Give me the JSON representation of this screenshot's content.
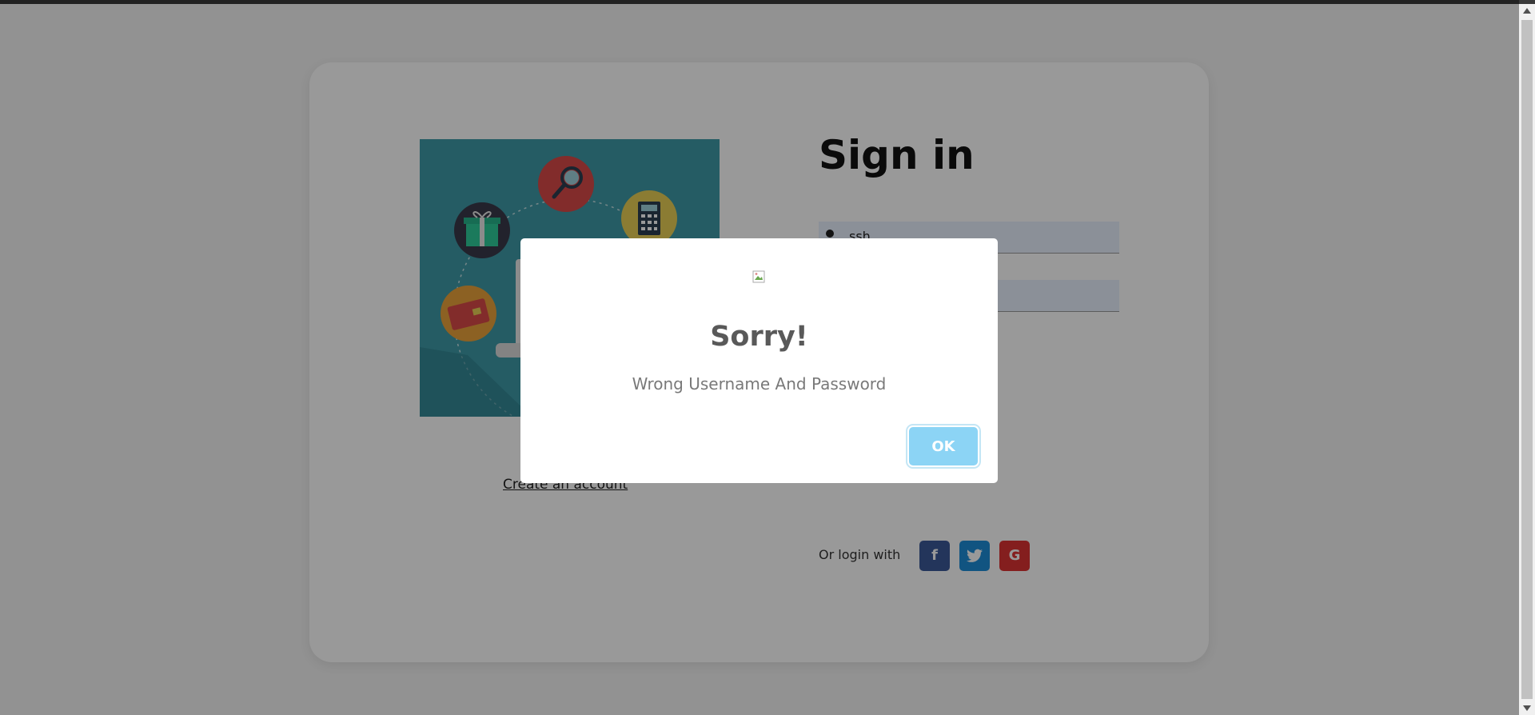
{
  "page": {
    "illustration_alt": "online shopping illustration",
    "create_account_link": "Create an account",
    "title": "Sign in",
    "username_value": "ssh",
    "password_value": "",
    "social_label": "Or login with",
    "social": {
      "facebook": "f",
      "twitter": "t",
      "google": "G"
    }
  },
  "modal": {
    "title": "Sorry!",
    "message": "Wrong Username And Password",
    "ok_label": "OK"
  },
  "colors": {
    "accent": "#8cd4f5",
    "facebook": "#3b5998",
    "twitter": "#1d8cd8",
    "google": "#dd3333",
    "illustration_bg": "#3e9aa7"
  }
}
